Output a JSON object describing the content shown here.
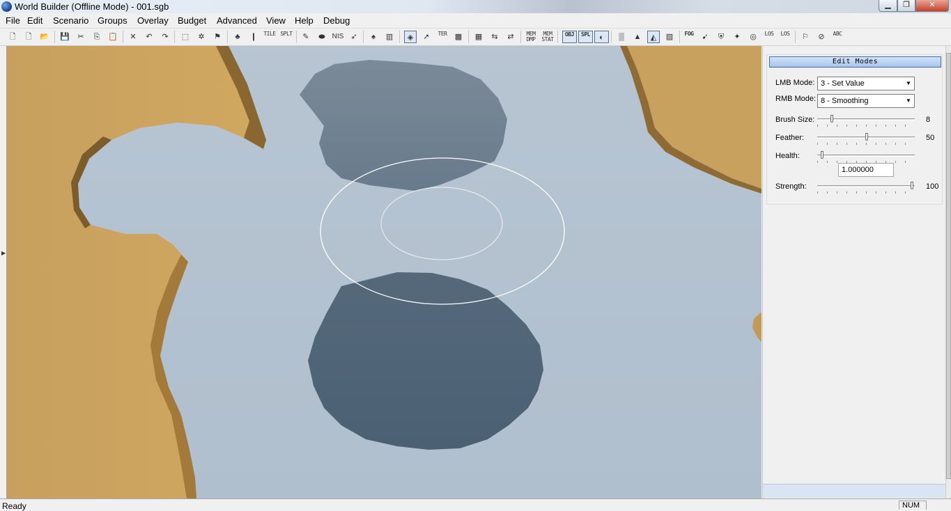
{
  "window": {
    "title": "World Builder (Offline Mode) - 001.sgb",
    "minimize_glyph": "▁",
    "maximize_glyph": "❐",
    "close_glyph": "✕"
  },
  "menu": [
    "File",
    "Edit",
    "Scenario",
    "Groups",
    "Overlay",
    "Budget",
    "Advanced",
    "View",
    "Help",
    "Debug"
  ],
  "toolbar": {
    "tile_label": "TILE",
    "splt_label": "SPLT",
    "nis_label": "NIS",
    "ter_label": "TER",
    "mem_dmp_label": "MEM DMP",
    "mem_stat_label": "MEM STAT",
    "obj_label": "OBJ",
    "spl_label": "SPL",
    "fog_label": "FOG",
    "los_label": "LOS",
    "los2_label": "LOS",
    "abc_label": "ABC"
  },
  "panel": {
    "header": "Edit Modes",
    "lmb_label": "LMB Mode:",
    "lmb_value": "3 - Set Value",
    "rmb_label": "RMB Mode:",
    "rmb_value": "8 - Smoothing",
    "brush_size_label": "Brush Size:",
    "brush_size_value": "8",
    "brush_size_fraction": 0.13,
    "feather_label": "Feather:",
    "feather_value": "50",
    "feather_fraction": 0.51,
    "health_label": "Health:",
    "health_fraction": 0.02,
    "health_value": "1.000000",
    "strength_label": "Strength:",
    "strength_value": "100",
    "strength_fraction": 1.0
  },
  "status": {
    "text": "Ready",
    "num_indicator": "NUM"
  },
  "colors": {
    "water": "#b4c3d2",
    "terrain": "#c89d58",
    "shadow_dark": "#4f6679",
    "shadow_light": "#6f8294",
    "brush_ring": "#ffffff"
  }
}
